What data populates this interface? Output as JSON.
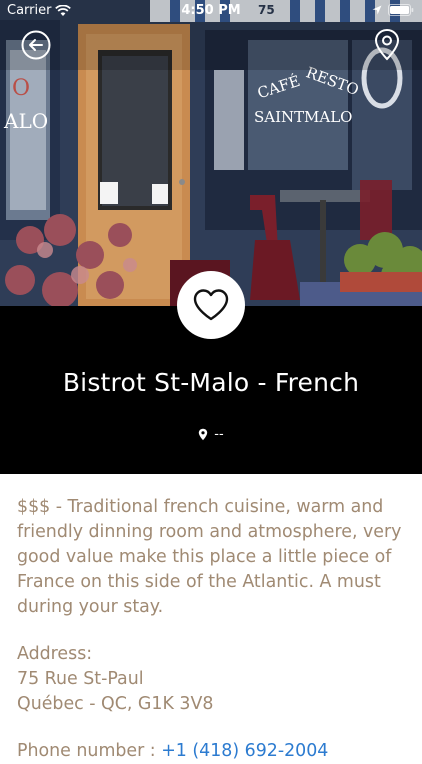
{
  "status_bar": {
    "carrier": "Carrier",
    "time": "4:50 PM"
  },
  "hero": {
    "sign_line1": "CAFÉ",
    "sign_line1b": "RESTO",
    "sign_line2": "SAINT",
    "sign_line2b": "MALO",
    "awning_number": "75"
  },
  "restaurant": {
    "name": "Bistrot St-Malo - French",
    "distance": "--"
  },
  "description": "$$$ - Traditional french cuisine, warm and friendly dinning room and atmosphere, very good value make this place a little piece of France on this side of the Atlantic. A must during your stay.",
  "address": {
    "label": "Address:",
    "line1": "75 Rue St-Paul",
    "line2": "Québec - QC, G1K 3V8"
  },
  "phone": {
    "label": "Phone number : ",
    "number": "+1 (418) 692-2004"
  },
  "colors": {
    "body_text": "#a08a73",
    "link": "#2c7bd0",
    "band": "#000000"
  },
  "icons": {
    "back": "back-arrow-circle-icon",
    "map": "map-pin-icon",
    "favorite": "heart-icon",
    "distance": "location-pin-icon"
  }
}
